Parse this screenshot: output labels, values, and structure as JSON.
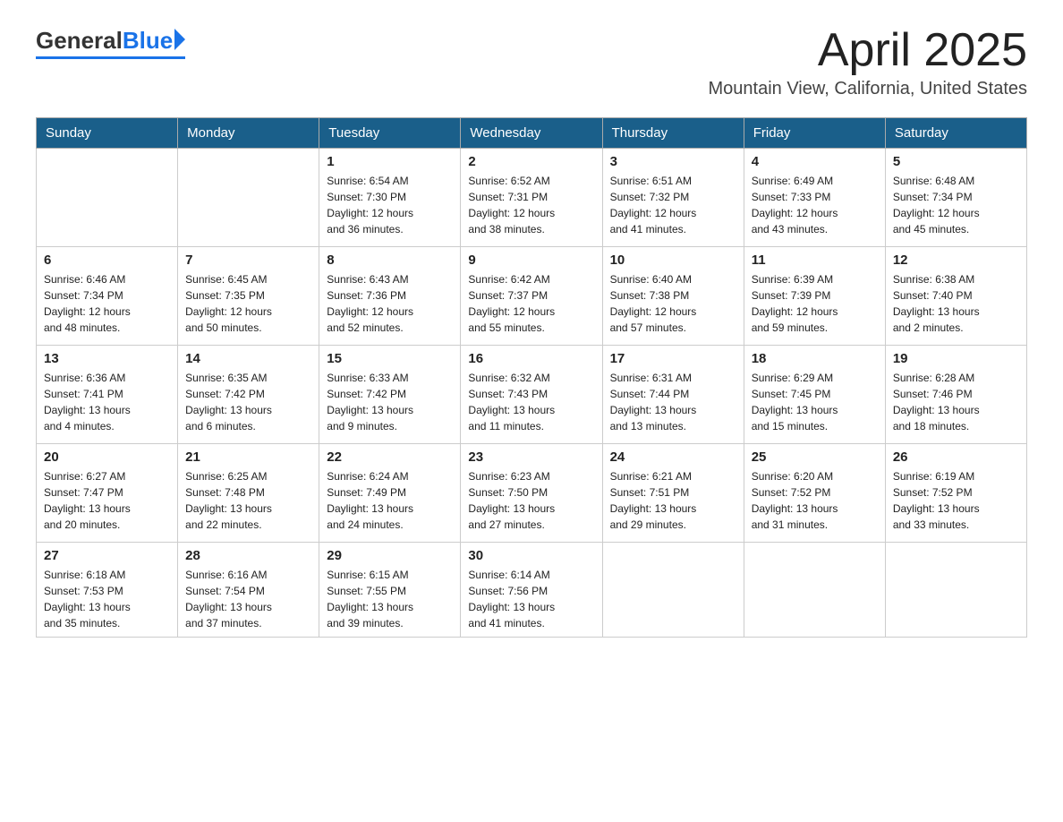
{
  "header": {
    "logo_general": "General",
    "logo_blue": "Blue",
    "month_title": "April 2025",
    "location": "Mountain View, California, United States"
  },
  "days_of_week": [
    "Sunday",
    "Monday",
    "Tuesday",
    "Wednesday",
    "Thursday",
    "Friday",
    "Saturday"
  ],
  "weeks": [
    [
      {
        "day": "",
        "info": ""
      },
      {
        "day": "",
        "info": ""
      },
      {
        "day": "1",
        "info": "Sunrise: 6:54 AM\nSunset: 7:30 PM\nDaylight: 12 hours\nand 36 minutes."
      },
      {
        "day": "2",
        "info": "Sunrise: 6:52 AM\nSunset: 7:31 PM\nDaylight: 12 hours\nand 38 minutes."
      },
      {
        "day": "3",
        "info": "Sunrise: 6:51 AM\nSunset: 7:32 PM\nDaylight: 12 hours\nand 41 minutes."
      },
      {
        "day": "4",
        "info": "Sunrise: 6:49 AM\nSunset: 7:33 PM\nDaylight: 12 hours\nand 43 minutes."
      },
      {
        "day": "5",
        "info": "Sunrise: 6:48 AM\nSunset: 7:34 PM\nDaylight: 12 hours\nand 45 minutes."
      }
    ],
    [
      {
        "day": "6",
        "info": "Sunrise: 6:46 AM\nSunset: 7:34 PM\nDaylight: 12 hours\nand 48 minutes."
      },
      {
        "day": "7",
        "info": "Sunrise: 6:45 AM\nSunset: 7:35 PM\nDaylight: 12 hours\nand 50 minutes."
      },
      {
        "day": "8",
        "info": "Sunrise: 6:43 AM\nSunset: 7:36 PM\nDaylight: 12 hours\nand 52 minutes."
      },
      {
        "day": "9",
        "info": "Sunrise: 6:42 AM\nSunset: 7:37 PM\nDaylight: 12 hours\nand 55 minutes."
      },
      {
        "day": "10",
        "info": "Sunrise: 6:40 AM\nSunset: 7:38 PM\nDaylight: 12 hours\nand 57 minutes."
      },
      {
        "day": "11",
        "info": "Sunrise: 6:39 AM\nSunset: 7:39 PM\nDaylight: 12 hours\nand 59 minutes."
      },
      {
        "day": "12",
        "info": "Sunrise: 6:38 AM\nSunset: 7:40 PM\nDaylight: 13 hours\nand 2 minutes."
      }
    ],
    [
      {
        "day": "13",
        "info": "Sunrise: 6:36 AM\nSunset: 7:41 PM\nDaylight: 13 hours\nand 4 minutes."
      },
      {
        "day": "14",
        "info": "Sunrise: 6:35 AM\nSunset: 7:42 PM\nDaylight: 13 hours\nand 6 minutes."
      },
      {
        "day": "15",
        "info": "Sunrise: 6:33 AM\nSunset: 7:42 PM\nDaylight: 13 hours\nand 9 minutes."
      },
      {
        "day": "16",
        "info": "Sunrise: 6:32 AM\nSunset: 7:43 PM\nDaylight: 13 hours\nand 11 minutes."
      },
      {
        "day": "17",
        "info": "Sunrise: 6:31 AM\nSunset: 7:44 PM\nDaylight: 13 hours\nand 13 minutes."
      },
      {
        "day": "18",
        "info": "Sunrise: 6:29 AM\nSunset: 7:45 PM\nDaylight: 13 hours\nand 15 minutes."
      },
      {
        "day": "19",
        "info": "Sunrise: 6:28 AM\nSunset: 7:46 PM\nDaylight: 13 hours\nand 18 minutes."
      }
    ],
    [
      {
        "day": "20",
        "info": "Sunrise: 6:27 AM\nSunset: 7:47 PM\nDaylight: 13 hours\nand 20 minutes."
      },
      {
        "day": "21",
        "info": "Sunrise: 6:25 AM\nSunset: 7:48 PM\nDaylight: 13 hours\nand 22 minutes."
      },
      {
        "day": "22",
        "info": "Sunrise: 6:24 AM\nSunset: 7:49 PM\nDaylight: 13 hours\nand 24 minutes."
      },
      {
        "day": "23",
        "info": "Sunrise: 6:23 AM\nSunset: 7:50 PM\nDaylight: 13 hours\nand 27 minutes."
      },
      {
        "day": "24",
        "info": "Sunrise: 6:21 AM\nSunset: 7:51 PM\nDaylight: 13 hours\nand 29 minutes."
      },
      {
        "day": "25",
        "info": "Sunrise: 6:20 AM\nSunset: 7:52 PM\nDaylight: 13 hours\nand 31 minutes."
      },
      {
        "day": "26",
        "info": "Sunrise: 6:19 AM\nSunset: 7:52 PM\nDaylight: 13 hours\nand 33 minutes."
      }
    ],
    [
      {
        "day": "27",
        "info": "Sunrise: 6:18 AM\nSunset: 7:53 PM\nDaylight: 13 hours\nand 35 minutes."
      },
      {
        "day": "28",
        "info": "Sunrise: 6:16 AM\nSunset: 7:54 PM\nDaylight: 13 hours\nand 37 minutes."
      },
      {
        "day": "29",
        "info": "Sunrise: 6:15 AM\nSunset: 7:55 PM\nDaylight: 13 hours\nand 39 minutes."
      },
      {
        "day": "30",
        "info": "Sunrise: 6:14 AM\nSunset: 7:56 PM\nDaylight: 13 hours\nand 41 minutes."
      },
      {
        "day": "",
        "info": ""
      },
      {
        "day": "",
        "info": ""
      },
      {
        "day": "",
        "info": ""
      }
    ]
  ]
}
